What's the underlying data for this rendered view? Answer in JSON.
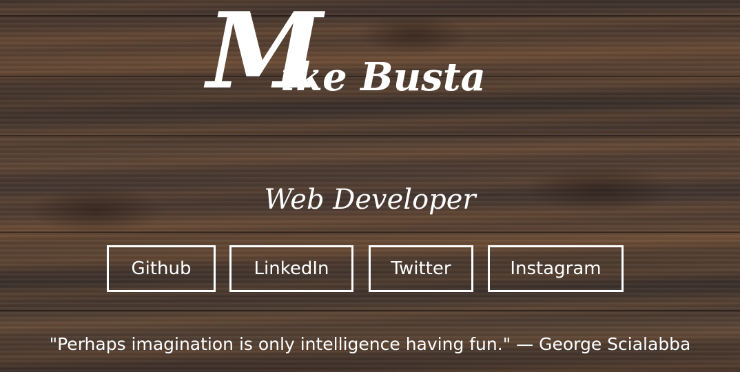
{
  "header": {
    "name_initial": "M",
    "name_rest": "ike Busta",
    "subtitle": "Web Developer"
  },
  "links": [
    {
      "label": "Github"
    },
    {
      "label": "LinkedIn"
    },
    {
      "label": "Twitter"
    },
    {
      "label": "Instagram"
    }
  ],
  "footer": {
    "quote": "\"Perhaps imagination is only intelligence having fun.\" — George Scialabba"
  },
  "colors": {
    "text": "#ffffff",
    "background_wood": "#4a3a30"
  }
}
